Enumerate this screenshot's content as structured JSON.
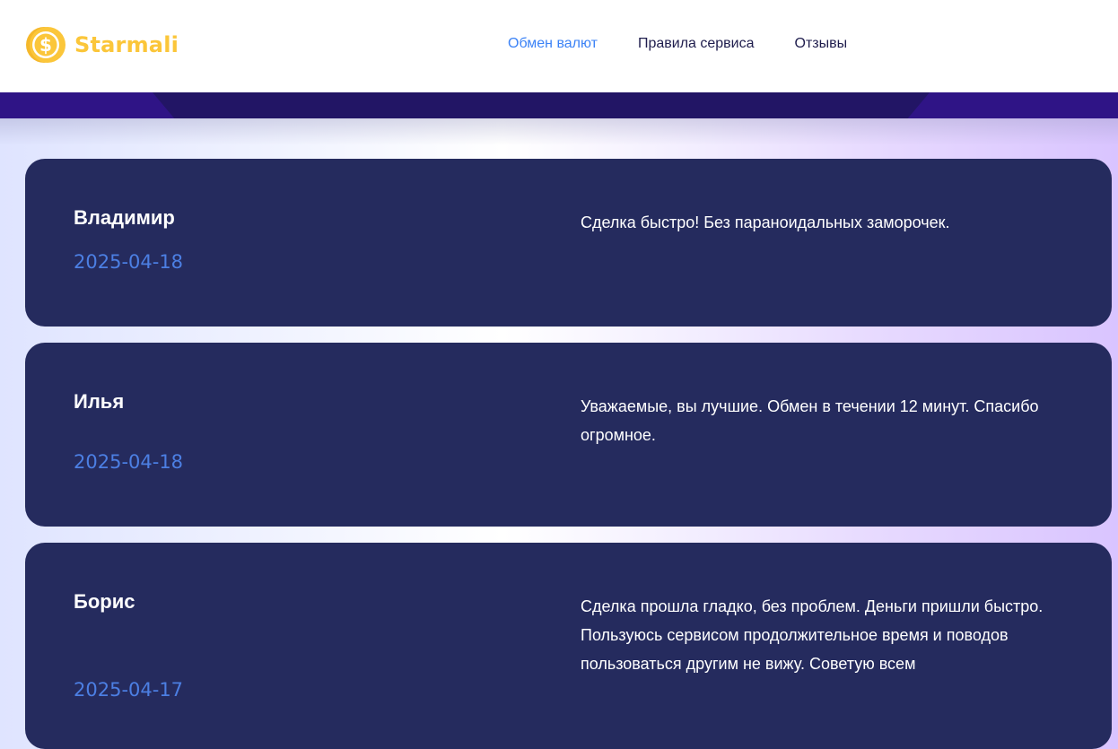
{
  "brand": {
    "name": "Starmali",
    "coin_color": "#fbc63a"
  },
  "nav": {
    "items": [
      {
        "label": "Обмен валют",
        "active": true
      },
      {
        "label": "Правила сервиса",
        "active": false
      },
      {
        "label": "Отзывы",
        "active": false
      }
    ]
  },
  "reviews": [
    {
      "name": "Владимир",
      "date": "2025-04-18",
      "text": "Сделка быстро! Без параноидальных заморочек."
    },
    {
      "name": "Илья",
      "date": "2025-04-18",
      "text": "Уважаемые, вы лучшие. Обмен в течении 12 минут. Спасибо огромное."
    },
    {
      "name": "Борис",
      "date": "2025-04-17",
      "text": "Сделка прошла гладко, без проблем. Деньги пришли быстро. Пользуюсь сервисом продолжительное время и поводов пользоваться другим не вижу. Советую всем"
    }
  ],
  "colors": {
    "card_background": "#252b5e",
    "date_color": "#4c7fe3",
    "nav_active": "#3b82f6",
    "nav_default": "#1f1d4d"
  }
}
